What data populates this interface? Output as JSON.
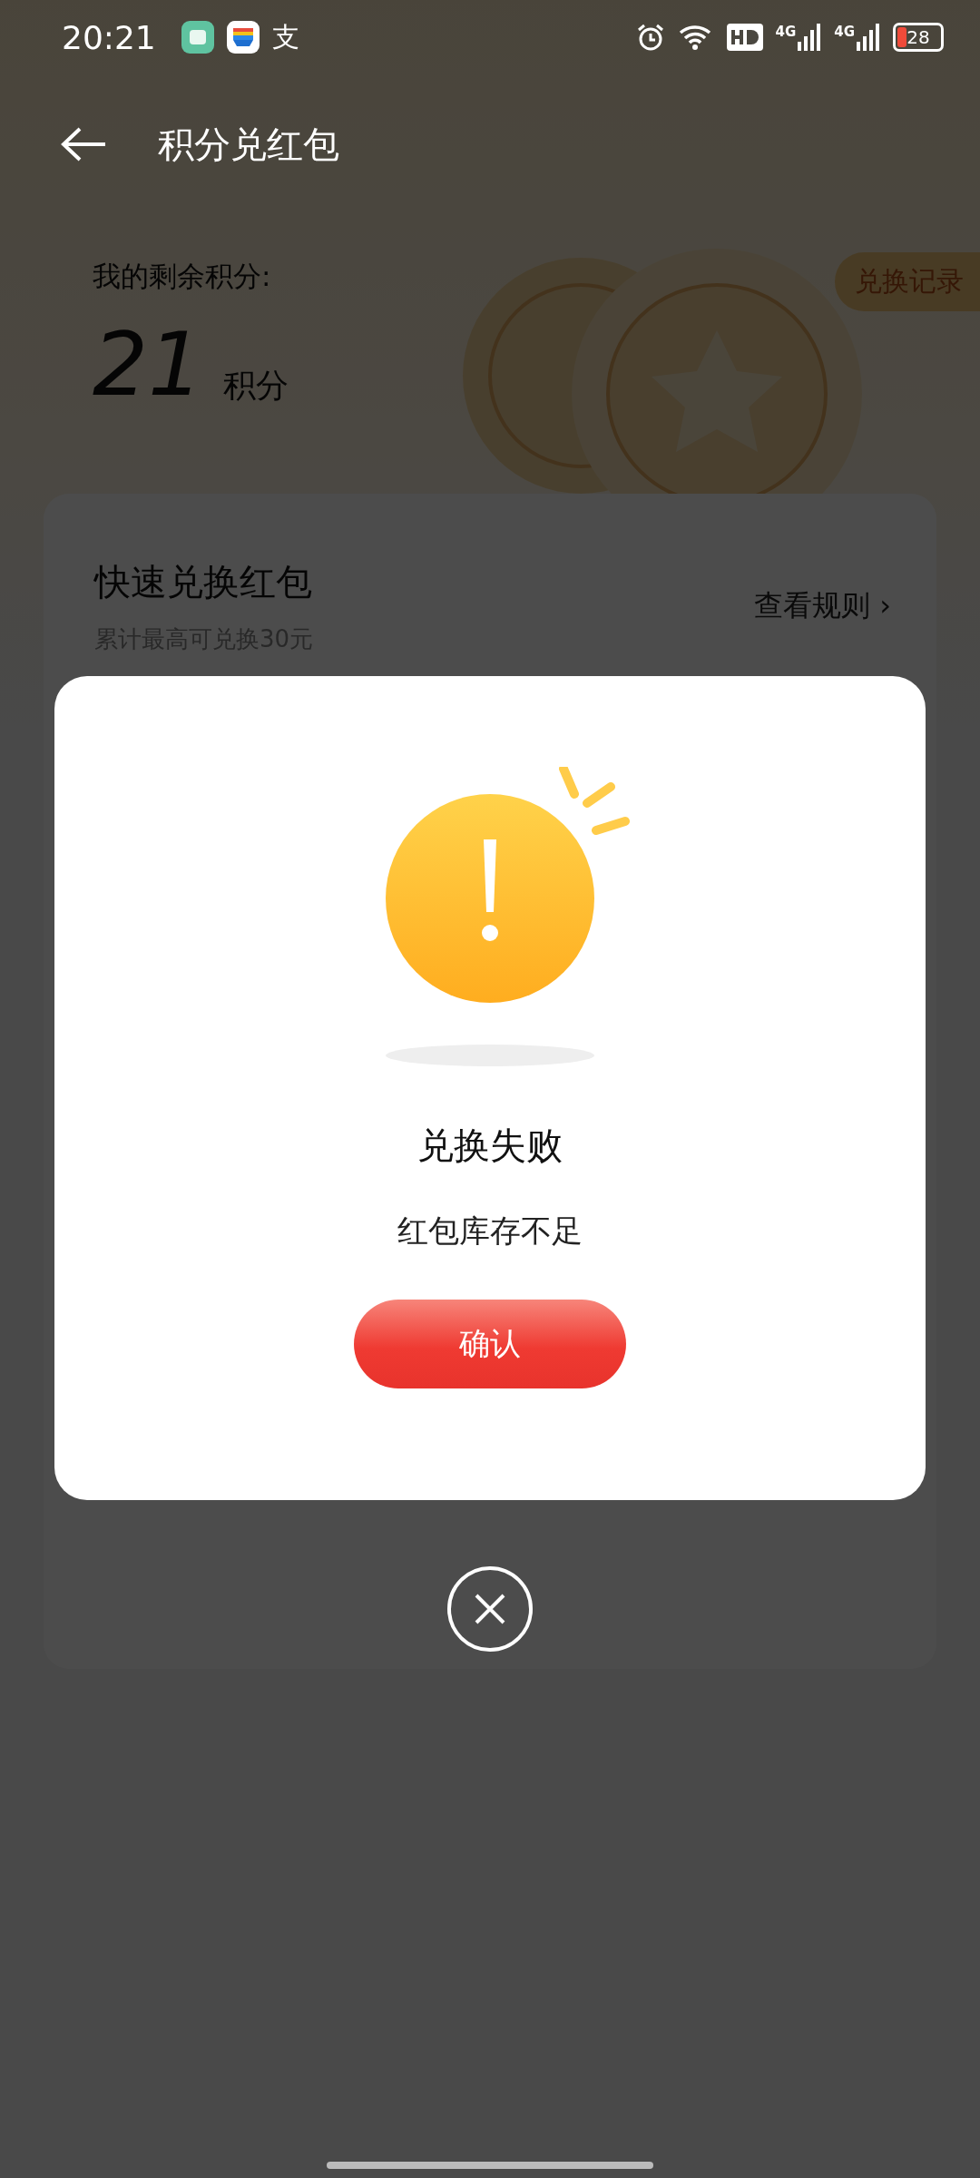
{
  "status_bar": {
    "time": "20:21",
    "app_icon_char": "支",
    "signals": [
      "4G",
      "4G"
    ],
    "battery": "28"
  },
  "header": {
    "title": "积分兑红包"
  },
  "points": {
    "label": "我的剩余积分:",
    "value": "21",
    "unit": "积分",
    "history_button": "兑换记录"
  },
  "card": {
    "title": "快速兑换红包",
    "subtitle": "累计最高可兑换30元",
    "rules_link": "查看规则 ›"
  },
  "dialog": {
    "title": "兑换失败",
    "message": "红包库存不足",
    "confirm_button": "确认"
  }
}
